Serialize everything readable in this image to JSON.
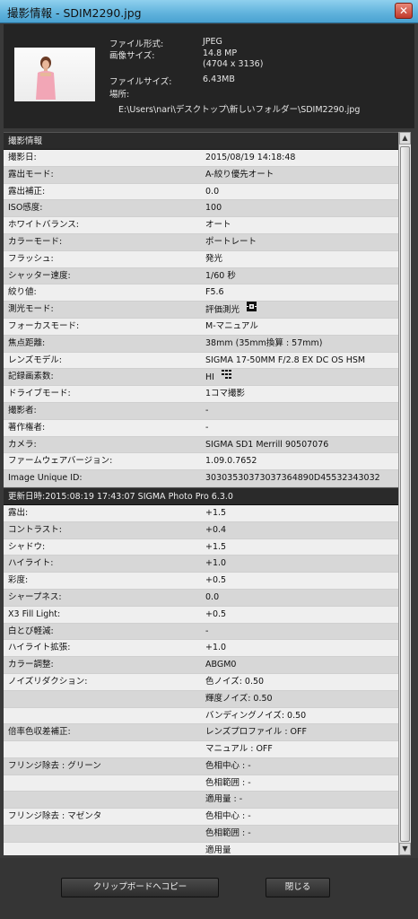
{
  "window": {
    "title": "撮影情報 - SDIM2290.jpg",
    "close_label": "✕"
  },
  "file": {
    "rows": [
      {
        "label": "ファイル形式:",
        "value": "JPEG"
      },
      {
        "label": "画像サイズ:",
        "value": "14.8 MP"
      },
      {
        "label": "",
        "value": "(4704 x 3136)"
      },
      {
        "label": "ファイルサイズ:",
        "value": "6.43MB"
      },
      {
        "label": "場所:",
        "value": ""
      }
    ],
    "path": "E:\\Users\\nari\\デスクトップ\\新しいフォルダー\\SDIM2290.jpg"
  },
  "shooting": {
    "header": "撮影情報",
    "rows": [
      {
        "label": "撮影日:",
        "value": "2015/08/19 14:18:48"
      },
      {
        "label": "露出モード:",
        "value": "A-絞り優先オート"
      },
      {
        "label": "露出補正:",
        "value": "0.0"
      },
      {
        "label": "ISO感度:",
        "value": "100"
      },
      {
        "label": "ホワイトバランス:",
        "value": "オート"
      },
      {
        "label": "カラーモード:",
        "value": "ポートレート"
      },
      {
        "label": "フラッシュ:",
        "value": "発光"
      },
      {
        "label": "シャッター速度:",
        "value": "1/60 秒"
      },
      {
        "label": "絞り値:",
        "value": "F5.6"
      },
      {
        "label": "測光モード:",
        "value": "評価測光",
        "icon": "metering-icon"
      },
      {
        "label": "フォーカスモード:",
        "value": "M-マニュアル"
      },
      {
        "label": "焦点距離:",
        "value": "38mm (35mm換算 : 57mm)"
      },
      {
        "label": "レンズモデル:",
        "value": "SIGMA 17-50MM F/2.8 EX DC OS HSM"
      },
      {
        "label": "記録画素数:",
        "value": "HI",
        "icon": "quality-grid-icon"
      },
      {
        "label": "ドライブモード:",
        "value": "1コマ撮影"
      },
      {
        "label": "撮影者:",
        "value": "-"
      },
      {
        "label": "著作権者:",
        "value": "-"
      },
      {
        "label": "カメラ:",
        "value": "SIGMA SD1 Merrill 90507076"
      },
      {
        "label": "ファームウェアバージョン:",
        "value": "1.09.0.7652"
      },
      {
        "label": "Image Unique ID:",
        "value": "30303530373037364890D45532343032"
      }
    ]
  },
  "edit": {
    "header": "更新日時:2015:08:19   17:43:07 SIGMA Photo Pro 6.3.0",
    "rows": [
      {
        "label": "露出:",
        "value": "+1.5"
      },
      {
        "label": "コントラスト:",
        "value": "+0.4"
      },
      {
        "label": "シャドウ:",
        "value": "+1.5"
      },
      {
        "label": "ハイライト:",
        "value": "+1.0"
      },
      {
        "label": "彩度:",
        "value": "+0.5"
      },
      {
        "label": "シャープネス:",
        "value": "0.0"
      },
      {
        "label": "X3 Fill Light:",
        "value": "+0.5"
      },
      {
        "label": "白とび軽減:",
        "value": "-"
      },
      {
        "label": "ハイライト拡張:",
        "value": "+1.0"
      },
      {
        "label": "カラー調整:",
        "value": "ABGM0"
      },
      {
        "label": "ノイズリダクション:",
        "value": "色ノイズ: 0.50"
      },
      {
        "label": "",
        "value": "輝度ノイズ: 0.50"
      },
      {
        "label": "",
        "value": "バンディングノイズ: 0.50"
      },
      {
        "label": "倍率色収差補正:",
        "value": "レンズプロファイル : OFF"
      },
      {
        "label": "",
        "value": "マニュアル : OFF"
      },
      {
        "label": "フリンジ除去 : グリーン",
        "value": "色相中心 : -"
      },
      {
        "label": "",
        "value": "色相範囲 : -"
      },
      {
        "label": "",
        "value": "適用量 : -"
      },
      {
        "label": "フリンジ除去 : マゼンタ",
        "value": "色相中心 : -"
      },
      {
        "label": "",
        "value": "色相範囲 : -"
      },
      {
        "label": "",
        "value": "適用量"
      }
    ]
  },
  "scrollbar": {
    "up": "▲",
    "down": "▼"
  },
  "buttons": {
    "copy": "クリップボードへコピー",
    "close": "閉じる"
  }
}
